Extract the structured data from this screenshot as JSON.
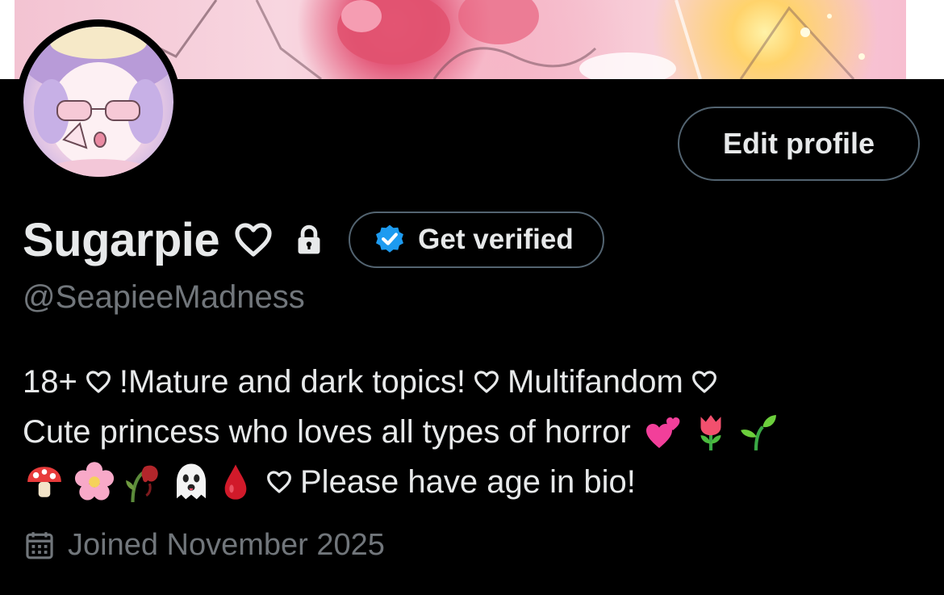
{
  "profile": {
    "display_name": "Sugarpie",
    "handle": "@SeapieeMadness",
    "edit_profile_label": "Edit profile",
    "get_verified_label": "Get verified",
    "bio_line1_part1": "18+",
    "bio_line1_part2": "!Mature and dark topics!",
    "bio_line1_part3": "Multifandom",
    "bio_line2": "Cute princess who loves all types of horror",
    "bio_line3_text": "Please have age in bio!",
    "bio_line2_emojis": [
      "two-hearts",
      "tulip",
      "seedling"
    ],
    "bio_line3_emojis": [
      "mushroom",
      "cherry-blossom",
      "wilted-flower",
      "ghost",
      "drop-of-blood"
    ],
    "joined": "Joined November 2025"
  },
  "colors": {
    "background": "#000000",
    "primary_text": "#e7e9ea",
    "secondary_text": "#71767b",
    "button_border": "#536471",
    "verified_blue": "#1d9bf0"
  },
  "icons": {
    "name_heart": "heart-outline-icon",
    "lock": "lock-icon",
    "verified": "verified-badge-icon",
    "calendar": "calendar-icon"
  }
}
